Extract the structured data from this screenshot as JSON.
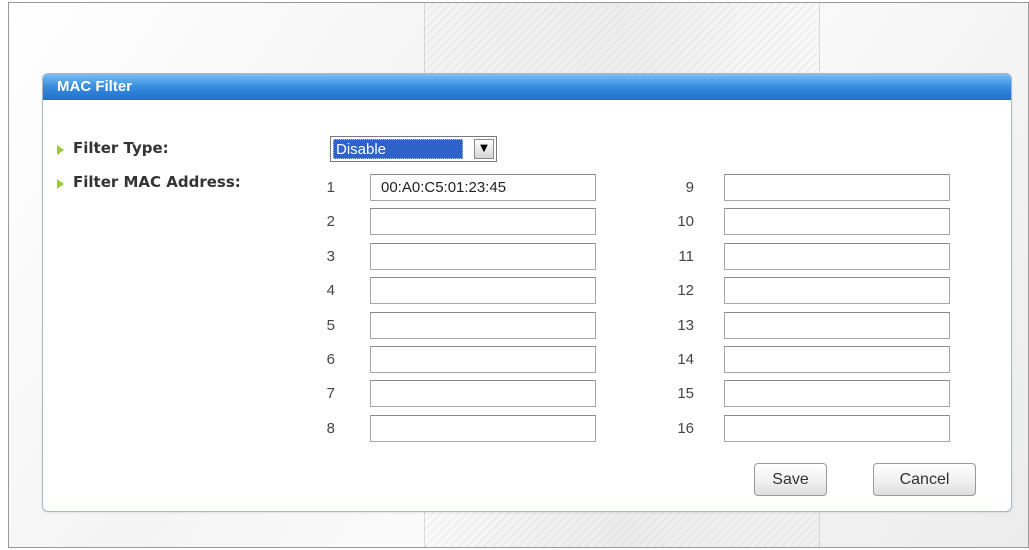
{
  "panel": {
    "title": "MAC Filter"
  },
  "filter_type": {
    "label": "Filter Type:",
    "selected": "Disable"
  },
  "filter_mac": {
    "label": "Filter MAC Address:",
    "left": [
      {
        "num": "1",
        "value": "00:A0:C5:01:23:45"
      },
      {
        "num": "2",
        "value": ""
      },
      {
        "num": "3",
        "value": ""
      },
      {
        "num": "4",
        "value": ""
      },
      {
        "num": "5",
        "value": ""
      },
      {
        "num": "6",
        "value": ""
      },
      {
        "num": "7",
        "value": ""
      },
      {
        "num": "8",
        "value": ""
      }
    ],
    "right": [
      {
        "num": "9",
        "value": ""
      },
      {
        "num": "10",
        "value": ""
      },
      {
        "num": "11",
        "value": ""
      },
      {
        "num": "12",
        "value": ""
      },
      {
        "num": "13",
        "value": ""
      },
      {
        "num": "14",
        "value": ""
      },
      {
        "num": "15",
        "value": ""
      },
      {
        "num": "16",
        "value": ""
      }
    ]
  },
  "buttons": {
    "save": "Save",
    "cancel": "Cancel"
  },
  "icons": {
    "bullet": "green-arrow-bullet-icon",
    "dropdown": "triangle-down-icon"
  },
  "colors": {
    "header": "#2f7fd8",
    "bullet": "#9bc93a",
    "selection": "#2f62c9"
  }
}
